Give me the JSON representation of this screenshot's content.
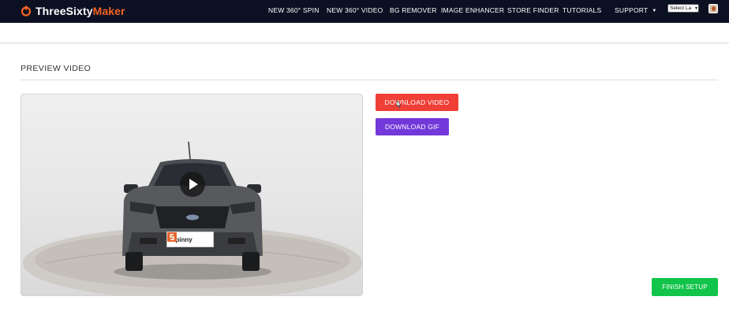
{
  "header": {
    "logo": {
      "prefix": "ThreeSixty",
      "accent": "Maker"
    },
    "nav": [
      {
        "label": "NEW 360° SPIN"
      },
      {
        "label": "NEW 360° VIDEO"
      },
      {
        "label": "BG REMOVER"
      },
      {
        "label": "IMAGE ENHANCER"
      },
      {
        "label": "STORE FINDER"
      },
      {
        "label": "TUTORIALS"
      },
      {
        "label": "SUPPORT",
        "has_dropdown": true
      }
    ],
    "language_select": {
      "value": "Select La"
    },
    "icons": {
      "logo": "threesixty-logo-icon",
      "dropdown": "chevron-down-icon",
      "avatar": "user-avatar-icon"
    }
  },
  "preview": {
    "title": "PREVIEW VIDEO",
    "plate_text": "Spinny",
    "icons": {
      "play": "play-icon",
      "plate_logo": "spinny-logo-icon"
    }
  },
  "actions": {
    "download_video": "DOWNLOAD VIDEO",
    "download_gif": "DOWNLOAD GIF",
    "finish_setup": "FINISH SETUP"
  },
  "colors": {
    "navbar_bg": "#0b1022",
    "accent_orange": "#f26322",
    "download_video_bg": "#ef3f36",
    "download_gif_bg": "#7338d9",
    "finish_bg": "#12c44a"
  }
}
